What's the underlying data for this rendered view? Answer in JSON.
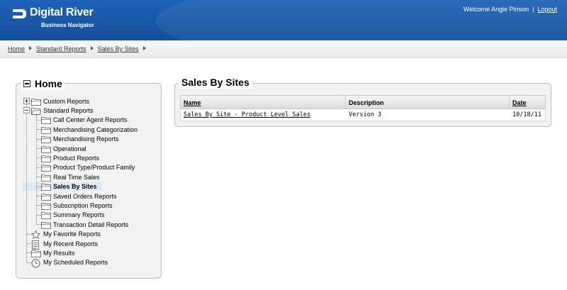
{
  "header": {
    "brand_name": "Digital River",
    "brand_sub": "Business Navigator",
    "welcome": "Welcome Angie Pinson",
    "separator": "|",
    "logout": "Logout"
  },
  "breadcrumb": [
    "Home",
    "Standard Reports",
    "Sales By Sites"
  ],
  "tree": {
    "title": "Home",
    "items": [
      {
        "label": "Custom Reports",
        "icon": "folder-icon",
        "expander": "plus"
      },
      {
        "label": "Standard Reports",
        "icon": "folder-open-icon",
        "expander": "minus"
      },
      {
        "label": "Call Center Agent Reports",
        "icon": "folder-icon"
      },
      {
        "label": "Merchandising Categorization",
        "icon": "folder-icon"
      },
      {
        "label": "Merchandising Reports",
        "icon": "folder-icon"
      },
      {
        "label": "Operational",
        "icon": "folder-icon"
      },
      {
        "label": "Product Reports",
        "icon": "folder-icon"
      },
      {
        "label": "Product Type/Product Family",
        "icon": "folder-icon"
      },
      {
        "label": "Real Time Sales",
        "icon": "folder-icon"
      },
      {
        "label": "Sales By Sites",
        "icon": "folder-icon",
        "selected": true
      },
      {
        "label": "Saved Orders Reports",
        "icon": "folder-icon"
      },
      {
        "label": "Subscription Reports",
        "icon": "folder-icon"
      },
      {
        "label": "Summary Reports",
        "icon": "folder-icon"
      },
      {
        "label": "Transaction Detail Reports",
        "icon": "folder-icon"
      },
      {
        "label": "My Favorite Reports",
        "icon": "star-icon"
      },
      {
        "label": "My Recent Reports",
        "icon": "document-list-icon"
      },
      {
        "label": "My Results",
        "icon": "folder-icon"
      },
      {
        "label": "My Scheduled Reports",
        "icon": "clock-icon"
      }
    ]
  },
  "main": {
    "title": "Sales By Sites",
    "columns": [
      "Name",
      "Description",
      "Date"
    ],
    "rows": [
      [
        "Sales By Site - Product Level Sales",
        "Version 3",
        "10/18/11"
      ]
    ]
  },
  "colors": {
    "header_blue": "#1a5aab",
    "panel_bg": "#f2f2f2",
    "selected_bg": "#dde8f7"
  }
}
